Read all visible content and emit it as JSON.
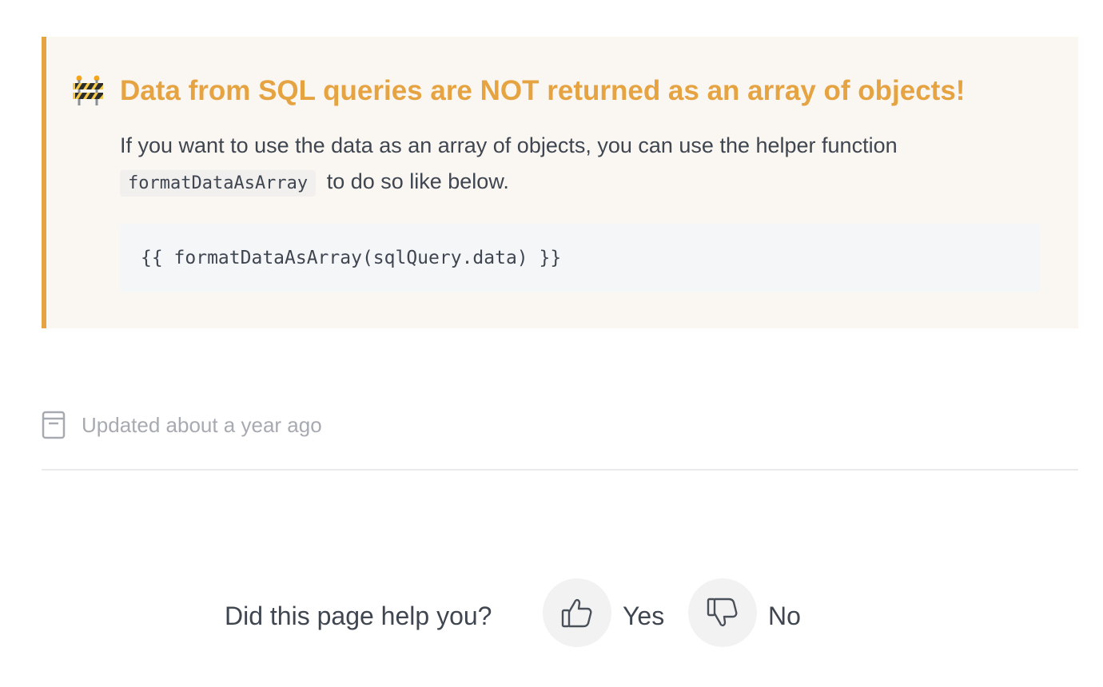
{
  "callout": {
    "icon": "construction-barrier-icon",
    "title": "Data from SQL queries are NOT returned as an array of objects!",
    "body_before_code": "If you want to use the data as an array of objects, you can use the helper function ",
    "inline_code": "formatDataAsArray",
    "body_after_code": "to do so like below.",
    "code_block": "{{ formatDataAsArray(sqlQuery.data) }}",
    "colors": {
      "accent": "#e6a341",
      "background": "#faf7f3"
    }
  },
  "meta": {
    "icon": "document-icon",
    "updated_text": "Updated about a year ago"
  },
  "feedback": {
    "question": "Did this page help you?",
    "yes_icon": "thumbs-up-icon",
    "yes_label": "Yes",
    "no_icon": "thumbs-down-icon",
    "no_label": "No"
  }
}
